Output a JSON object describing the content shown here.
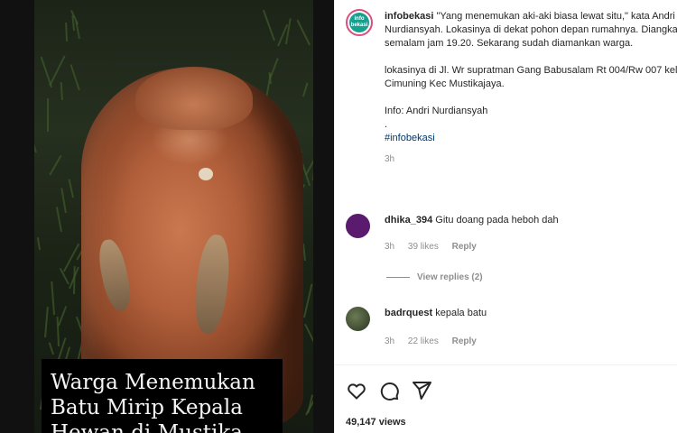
{
  "image_caption": {
    "lines": [
      "Warga Menemukan",
      "Batu Mirip Kepala",
      "Hewan di Mustika"
    ]
  },
  "post": {
    "author_avatar_text": [
      "info",
      "bekasi"
    ],
    "author": "infobekasi",
    "lines": [
      "\"Yang menemukan aki-aki biasa lewat situ,\" kata Andri",
      "Nurdiansyah. Lokasinya di dekat pohon depan rumahnya. Diangkat",
      "semalam jam 19.20. Sekarang sudah diamankan warga."
    ],
    "location_lines": [
      "lokasinya di Jl. Wr supratman Gang Babusalam Rt 004/Rw 007 kel",
      "Cimuning Kec Mustikajaya."
    ],
    "info_line": "Info: Andri Nurdiansyah",
    "dot": ".",
    "hashtag": "#infobekasi",
    "time": "3h"
  },
  "comments": [
    {
      "user": "dhika_394",
      "text": "Gitu doang pada heboh dah",
      "time": "3h",
      "likes": "39 likes",
      "reply": "Reply",
      "avatar_color": "#5a1a6e"
    },
    {
      "user": "badrquest",
      "text": "kepala batu",
      "time": "3h",
      "likes": "22 likes",
      "reply": "Reply",
      "avatar_color": "#3b4a2e"
    }
  ],
  "view_replies": "View replies (2)",
  "actions": {
    "icons": [
      "heart-icon",
      "comment-icon",
      "share-icon"
    ]
  },
  "views": "49,147 views",
  "colors": {
    "avatar_ring": "#d94f7d",
    "brand_teal": "#16a08f",
    "hashtag": "#00376b",
    "muted": "#8e8e8e"
  }
}
